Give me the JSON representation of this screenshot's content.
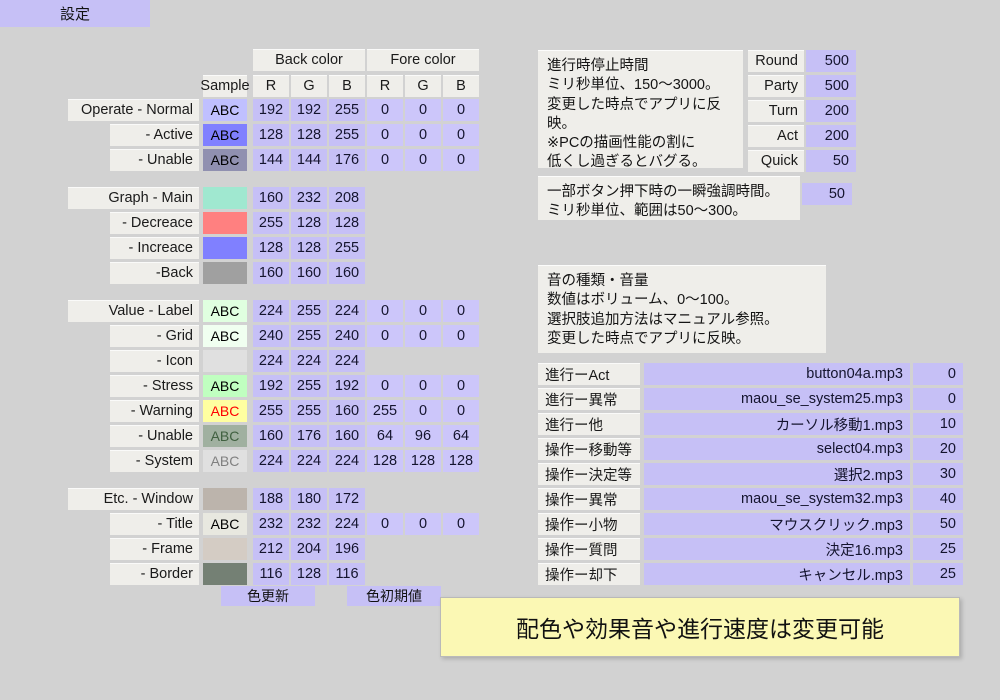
{
  "window": {
    "tab_label": "設定"
  },
  "palette": {
    "accent": "#c6c0f6",
    "label_bg": "#efeeea",
    "page_bg": "#d2d2d2",
    "banner_bg": "#fbf8b4"
  },
  "color_table": {
    "group_headers": {
      "back": "Back color",
      "fore": "Fore color"
    },
    "columns": [
      "Sample",
      "R",
      "G",
      "B",
      "R",
      "G",
      "B"
    ],
    "rows": [
      {
        "label": "Operate - Normal",
        "level": "main",
        "sample_text": "ABC",
        "back": [
          192,
          192,
          255
        ],
        "fore": [
          0,
          0,
          0
        ],
        "has_fore": true
      },
      {
        "label": "- Active",
        "level": "sub",
        "sample_text": "ABC",
        "back": [
          128,
          128,
          255
        ],
        "fore": [
          0,
          0,
          0
        ],
        "has_fore": true
      },
      {
        "label": "- Unable",
        "level": "sub",
        "sample_text": "ABC",
        "back": [
          144,
          144,
          176
        ],
        "fore": [
          0,
          0,
          0
        ],
        "has_fore": true
      },
      {
        "spacer": true
      },
      {
        "label": "Graph - Main",
        "level": "main",
        "sample_text": "",
        "back": [
          160,
          232,
          208
        ],
        "has_fore": false
      },
      {
        "label": "- Decreace",
        "level": "sub",
        "sample_text": "",
        "back": [
          255,
          128,
          128
        ],
        "has_fore": false
      },
      {
        "label": "- Increace",
        "level": "sub",
        "sample_text": "",
        "back": [
          128,
          128,
          255
        ],
        "has_fore": false
      },
      {
        "label": "-Back",
        "level": "sub",
        "sample_text": "",
        "back": [
          160,
          160,
          160
        ],
        "has_fore": false
      },
      {
        "spacer": true
      },
      {
        "label": "Value - Label",
        "level": "main",
        "sample_text": "ABC",
        "back": [
          224,
          255,
          224
        ],
        "fore": [
          0,
          0,
          0
        ],
        "has_fore": true
      },
      {
        "label": "- Grid",
        "level": "sub",
        "sample_text": "ABC",
        "back": [
          240,
          255,
          240
        ],
        "fore": [
          0,
          0,
          0
        ],
        "has_fore": true
      },
      {
        "label": "- Icon",
        "level": "sub",
        "sample_text": "",
        "back": [
          224,
          224,
          224
        ],
        "has_fore": false
      },
      {
        "label": "- Stress",
        "level": "sub",
        "sample_text": "ABC",
        "back": [
          192,
          255,
          192
        ],
        "fore": [
          0,
          0,
          0
        ],
        "has_fore": true
      },
      {
        "label": "- Warning",
        "level": "sub",
        "sample_text": "ABC",
        "back": [
          255,
          255,
          160
        ],
        "fore": [
          255,
          0,
          0
        ],
        "has_fore": true
      },
      {
        "label": "- Unable",
        "level": "sub",
        "sample_text": "ABC",
        "back": [
          160,
          176,
          160
        ],
        "fore": [
          64,
          96,
          64
        ],
        "has_fore": true
      },
      {
        "label": "- System",
        "level": "sub",
        "sample_text": "ABC",
        "back": [
          224,
          224,
          224
        ],
        "fore": [
          128,
          128,
          128
        ],
        "has_fore": true
      },
      {
        "spacer": true
      },
      {
        "label": "Etc. - Window",
        "level": "main",
        "sample_text": "",
        "back": [
          188,
          180,
          172
        ],
        "has_fore": false
      },
      {
        "label": "- Title",
        "level": "sub",
        "sample_text": "ABC",
        "back": [
          232,
          232,
          224
        ],
        "fore": [
          0,
          0,
          0
        ],
        "has_fore": true
      },
      {
        "label": "- Frame",
        "level": "sub",
        "sample_text": "",
        "back": [
          212,
          204,
          196
        ],
        "has_fore": false
      },
      {
        "label": "- Border",
        "level": "sub",
        "sample_text": "",
        "back": [
          116,
          128,
          116
        ],
        "has_fore": false
      }
    ]
  },
  "buttons": {
    "color_update": "色更新",
    "color_default": "色初期値"
  },
  "speed_panel": {
    "info_text": "進行時停止時間\nミリ秒単位、150〜3000。\n変更した時点でアプリに反映。\n※PCの描画性能の割に\n低くし過ぎるとバグる。",
    "rows": [
      {
        "label": "Round",
        "value": "500"
      },
      {
        "label": "Party",
        "value": "500"
      },
      {
        "label": "Turn",
        "value": "200"
      },
      {
        "label": "Act",
        "value": "200"
      },
      {
        "label": "Quick",
        "value": "50"
      }
    ]
  },
  "highlight_panel": {
    "info_text": "一部ボタン押下時の一瞬強調時間。\nミリ秒単位、範囲は50〜300。",
    "value": "50"
  },
  "sound_panel": {
    "info_text": "音の種類・音量\n数値はボリューム、0〜100。\n選択肢追加方法はマニュアル参照。\n変更した時点でアプリに反映。",
    "rows": [
      {
        "label": "進行ーAct",
        "file": "button04a.mp3",
        "volume": "0"
      },
      {
        "label": "進行ー異常",
        "file": "maou_se_system25.mp3",
        "volume": "0"
      },
      {
        "label": "進行ー他",
        "file": "カーソル移動1.mp3",
        "volume": "10"
      },
      {
        "label": "操作ー移動等",
        "file": "select04.mp3",
        "volume": "20"
      },
      {
        "label": "操作ー決定等",
        "file": "選択2.mp3",
        "volume": "30"
      },
      {
        "label": "操作ー異常",
        "file": "maou_se_system32.mp3",
        "volume": "40"
      },
      {
        "label": "操作ー小物",
        "file": "マウスクリック.mp3",
        "volume": "50"
      },
      {
        "label": "操作ー質問",
        "file": "決定16.mp3",
        "volume": "25"
      },
      {
        "label": "操作ー却下",
        "file": "キャンセル.mp3",
        "volume": "25"
      }
    ]
  },
  "banner": {
    "text": "配色や効果音や進行速度は変更可能"
  }
}
